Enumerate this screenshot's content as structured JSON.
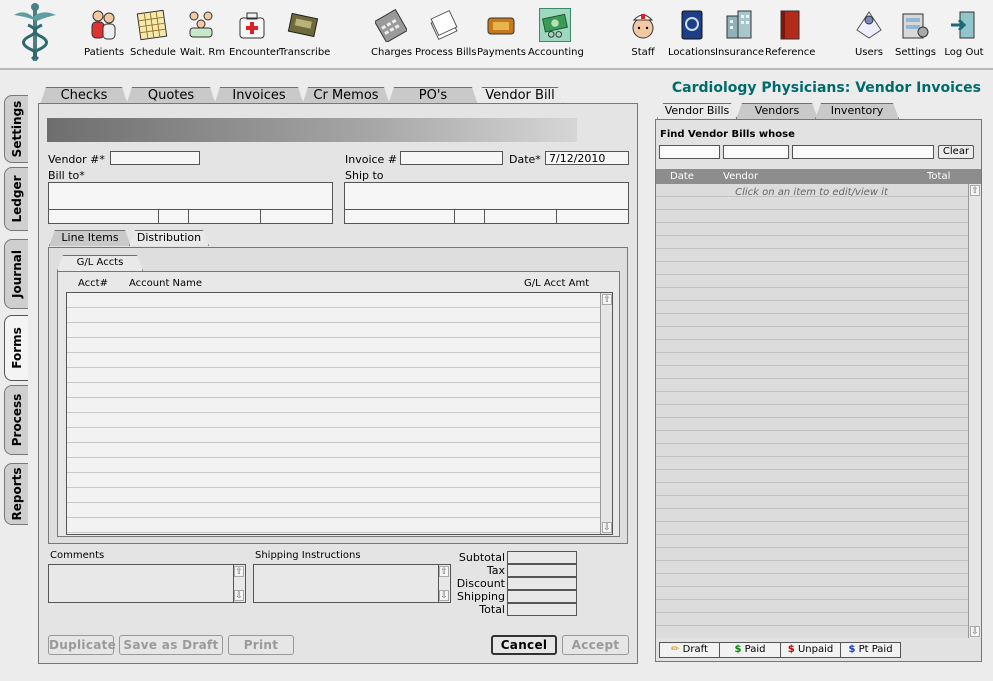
{
  "toolbar": {
    "items": [
      {
        "label": "Patients",
        "icon": "patients-icon"
      },
      {
        "label": "Schedule",
        "icon": "calendar-icon"
      },
      {
        "label": "Wait. Rm",
        "icon": "waiting-room-icon"
      },
      {
        "label": "Encounter",
        "icon": "medical-bag-icon"
      },
      {
        "label": "Transcribe",
        "icon": "cassette-icon"
      },
      {
        "label": "Charges",
        "icon": "calculator-icon"
      },
      {
        "label": "Process Bills",
        "icon": "papers-stack-icon"
      },
      {
        "label": "Payments",
        "icon": "wallet-icon"
      },
      {
        "label": "Accounting",
        "icon": "money-icon"
      },
      {
        "label": "Staff",
        "icon": "nurse-icon"
      },
      {
        "label": "Locations",
        "icon": "address-book-icon"
      },
      {
        "label": "Insurance",
        "icon": "building-icon"
      },
      {
        "label": "Reference",
        "icon": "book-icon"
      },
      {
        "label": "Users",
        "icon": "users-icon"
      },
      {
        "label": "Settings",
        "icon": "settings-icon"
      },
      {
        "label": "Log Out",
        "icon": "door-exit-icon"
      }
    ]
  },
  "side_tabs": {
    "settings": "Settings",
    "ledger": "Ledger",
    "journal": "Journal",
    "forms": "Forms",
    "process": "Process",
    "reports": "Reports",
    "active": "Forms"
  },
  "page_title": "Cardiology Physicians:  Vendor Invoices",
  "doc_tabs": [
    "Checks",
    "Quotes",
    "Invoices",
    "Cr Memos",
    "PO's",
    "Vendor Bill"
  ],
  "doc_tabs_active": "Vendor Bill",
  "form": {
    "vendor_label": "Vendor #*",
    "vendor_value": "",
    "invoice_label": "Invoice #",
    "invoice_value": "",
    "date_label": "Date*",
    "date_value": "7/12/2010",
    "bill_to_label": "Bill to*",
    "ship_to_label": "Ship to"
  },
  "sub_tabs": [
    "Line Items",
    "Distribution"
  ],
  "sub_tabs_active": "Distribution",
  "gl": {
    "tab_label": "G/L Accts",
    "col_acct": "Acct#",
    "col_name": "Account Name",
    "col_amt": "G/L Acct Amt"
  },
  "bottom": {
    "comments_label": "Comments",
    "shipping_label": "Shipping Instructions",
    "totals": [
      "Subtotal",
      "Tax",
      "Discount",
      "Shipping",
      "Total"
    ]
  },
  "buttons": {
    "duplicate": "Duplicate",
    "save_draft": "Save as Draft",
    "print": "Print",
    "cancel": "Cancel",
    "accept": "Accept"
  },
  "right": {
    "tabs": [
      "Vendor Bills",
      "Vendors",
      "Inventory"
    ],
    "tabs_active": "Vendor Bills",
    "find_label": "Find Vendor Bills whose",
    "clear": "Clear",
    "col_date": "Date",
    "col_vendor": "Vendor",
    "col_total": "Total",
    "hint": "Click on an item to edit/view it",
    "legend": [
      {
        "label": "Draft",
        "mark": "✏",
        "color": "#c59a00"
      },
      {
        "label": "Paid",
        "mark": "$",
        "color": "#008a00"
      },
      {
        "label": "Unpaid",
        "mark": "$",
        "color": "#cc0000"
      },
      {
        "label": "Pt Paid",
        "mark": "$",
        "color": "#1a3fc0"
      }
    ]
  },
  "colors": {
    "title": "#006b6b"
  }
}
